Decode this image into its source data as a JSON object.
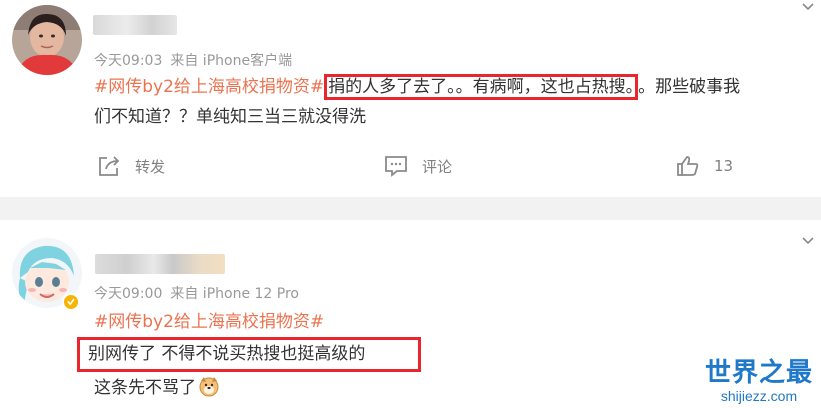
{
  "posts": [
    {
      "meta": {
        "time": "今天09:03",
        "source": "来自 iPhone客户端"
      },
      "content": {
        "hashtag": "#网传by2给上海高校捐物资#",
        "highlighted": "捐的人多了去了。。有病啊，这也占热搜。",
        "rest_line1": "。那些破事我",
        "line2": "们不知道？？单纯知三当三就没得洗"
      },
      "actions": {
        "repost": "转发",
        "comment": "评论",
        "like_count": "13"
      }
    },
    {
      "meta": {
        "time": "今天09:00",
        "source": "来自 iPhone 12 Pro"
      },
      "content": {
        "hashtag": "#网传by2给上海高校捐物资#",
        "boxed": "别网传了 不得不说买热搜也挺高级的",
        "last": "这条先不骂了"
      }
    }
  ],
  "watermark": {
    "cn": "世界之最",
    "en": "shijiezz.com"
  },
  "colors": {
    "hashtag": "#eb7350",
    "highlight_border": "#e8262d",
    "meta": "#999999",
    "watermark": "#1f78c8"
  }
}
